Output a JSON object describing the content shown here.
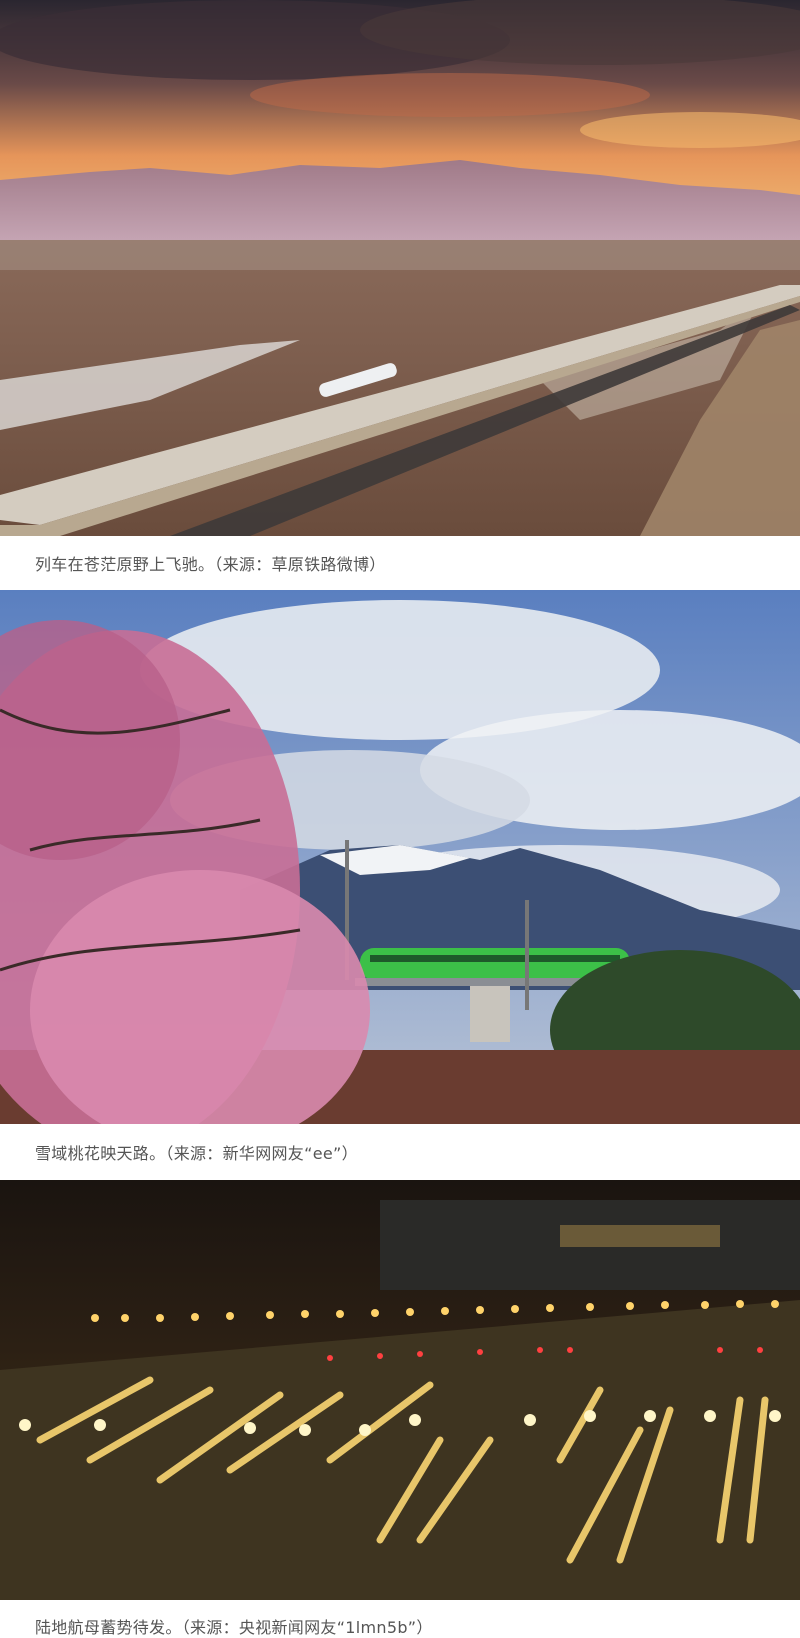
{
  "photos": [
    {
      "scene": "train-on-plateau",
      "caption": "列车在苍茫原野上飞驰。（来源：草原铁路微博）"
    },
    {
      "scene": "peach-blossom-train",
      "caption": "雪域桃花映天路。（来源：新华网网友“ee”）"
    },
    {
      "scene": "rail-yard-night",
      "caption": "陆地航母蓄势待发。（来源：央视新闻网友“1lmn5b”）"
    }
  ],
  "colors": {
    "caption_text": "#555555",
    "sunset_orange": "#f0a050",
    "train_green": "#3cc048",
    "night_light": "#ffd36a"
  }
}
